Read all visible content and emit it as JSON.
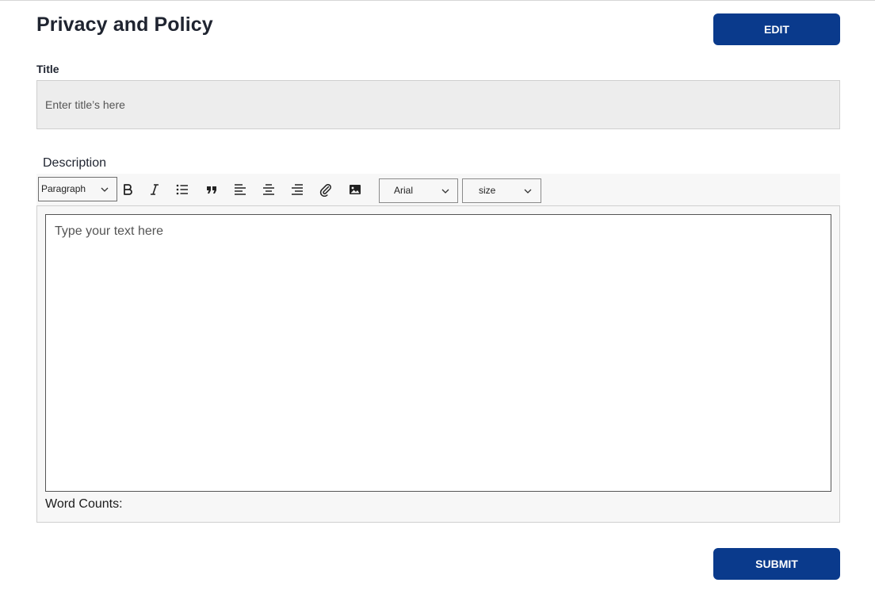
{
  "page": {
    "title": "Privacy and Policy",
    "edit_label": "EDIT",
    "submit_label": "SUBMIT"
  },
  "title_field": {
    "label": "Title",
    "placeholder": "Enter title’s here",
    "value": ""
  },
  "description": {
    "label": "Description",
    "editor_placeholder": "Type your text here",
    "word_count_label": "Word Counts:"
  },
  "toolbar": {
    "paragraph_value": "Paragraph",
    "font_value": "Arial",
    "size_value": "size",
    "icons": [
      "bold-icon",
      "italic-icon",
      "bullet-list-icon",
      "quote-icon",
      "align-left-icon",
      "align-center-icon",
      "align-right-icon",
      "attachment-icon",
      "image-icon"
    ]
  },
  "colors": {
    "primary": "#0a3a8c",
    "input_background": "#ededed",
    "toolbar_background": "#f7f7f7"
  }
}
